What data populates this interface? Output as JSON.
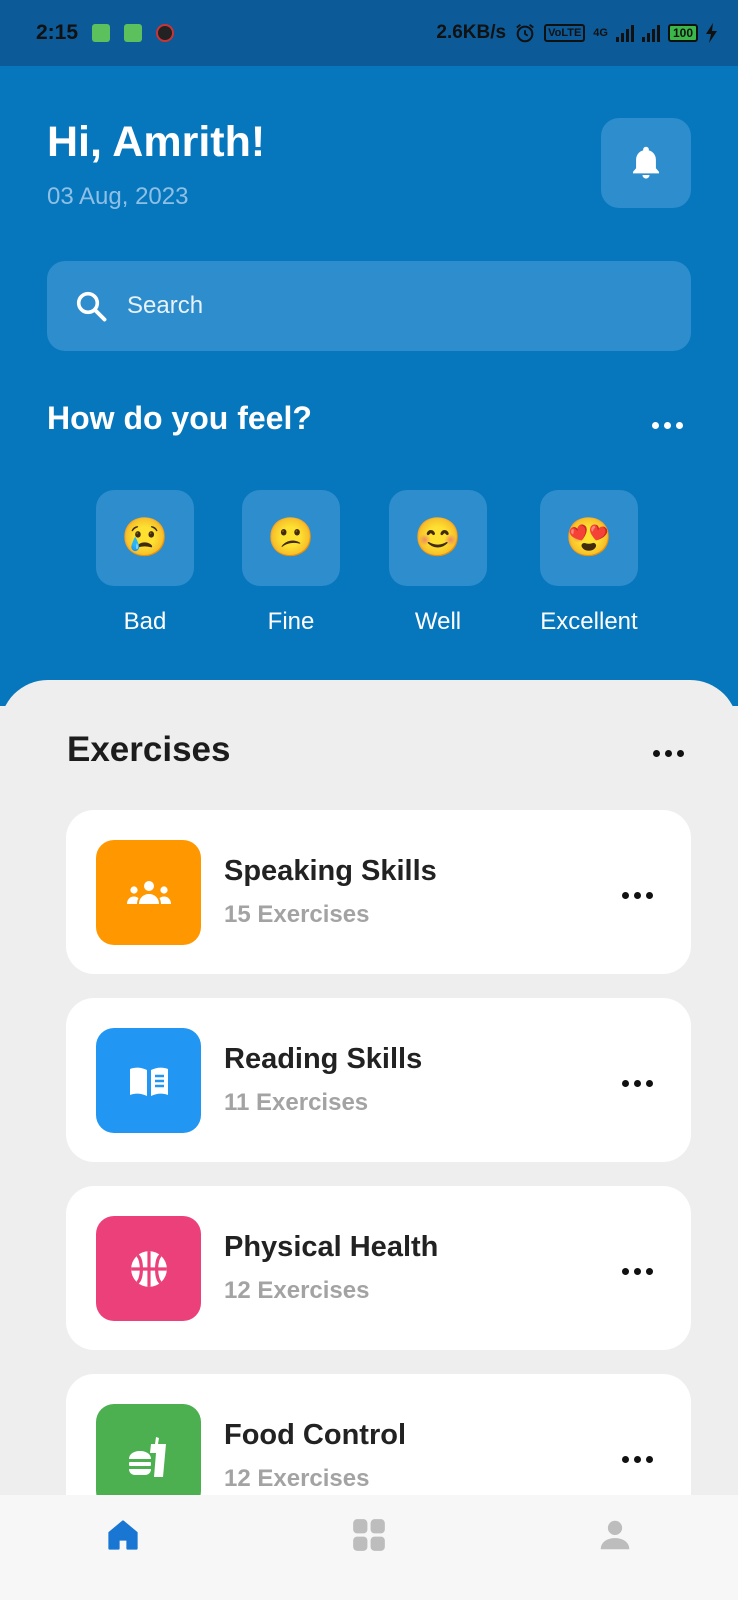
{
  "status_bar": {
    "time": "2:15",
    "speed": "2.6KB/s",
    "network_badge": "VoLTE",
    "network_type": "4G",
    "battery": "100"
  },
  "header": {
    "greeting": "Hi, Amrith!",
    "date": "03 Aug, 2023",
    "bell_icon": "bell-icon"
  },
  "search": {
    "placeholder": "Search"
  },
  "feel": {
    "title": "How do you feel?",
    "moods": [
      {
        "label": "Bad",
        "emoji": "😢"
      },
      {
        "label": "Fine",
        "emoji": "😕"
      },
      {
        "label": "Well",
        "emoji": "😊"
      },
      {
        "label": "Excellent",
        "emoji": "😍"
      }
    ]
  },
  "exercises": {
    "title": "Exercises",
    "items": [
      {
        "name": "Speaking Skills",
        "count": "15 Exercises",
        "color": "#ff9800",
        "icon": "group-icon"
      },
      {
        "name": "Reading Skills",
        "count": "11 Exercises",
        "color": "#2196f3",
        "icon": "book-icon"
      },
      {
        "name": "Physical Health",
        "count": "12 Exercises",
        "color": "#ec407a",
        "icon": "basketball-icon"
      },
      {
        "name": "Food Control",
        "count": "12 Exercises",
        "color": "#4caf50",
        "icon": "fastfood-icon"
      }
    ]
  },
  "nav": {
    "items": [
      {
        "name": "home",
        "icon": "home-icon",
        "active_color": "#1976d2"
      },
      {
        "name": "dashboard",
        "icon": "grid-icon"
      },
      {
        "name": "profile",
        "icon": "person-icon"
      }
    ]
  },
  "colors": {
    "header_bg": "#0676bd",
    "tile_bg": "#2e8dcc",
    "content_bg": "#eeeeee"
  }
}
